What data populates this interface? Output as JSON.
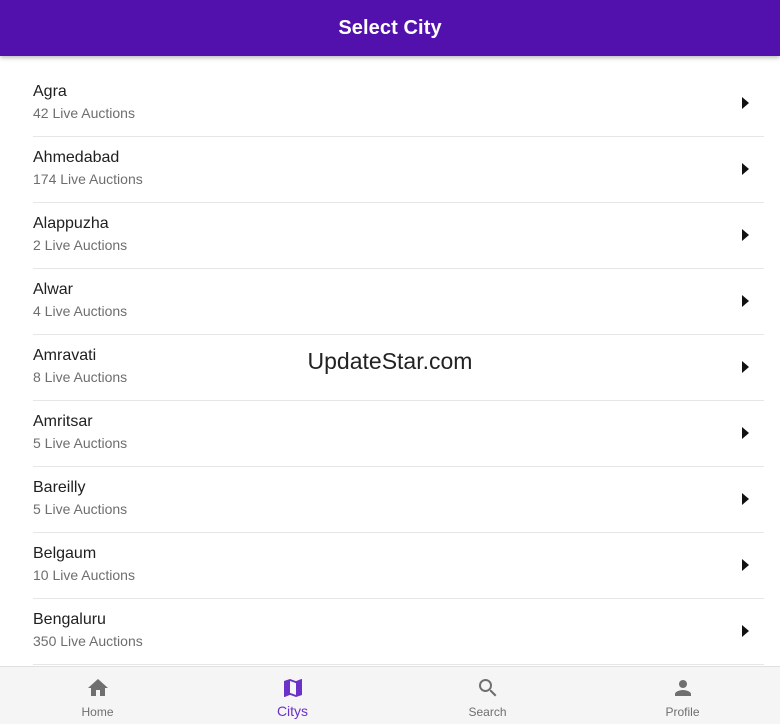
{
  "header": {
    "title": "Select City"
  },
  "cities": [
    {
      "name": "Agra",
      "count": "42 Live Auctions"
    },
    {
      "name": "Ahmedabad",
      "count": "174 Live Auctions"
    },
    {
      "name": "Alappuzha",
      "count": "2 Live Auctions"
    },
    {
      "name": "Alwar",
      "count": "4 Live Auctions"
    },
    {
      "name": "Amravati",
      "count": "8 Live Auctions"
    },
    {
      "name": "Amritsar",
      "count": "5 Live Auctions"
    },
    {
      "name": "Bareilly",
      "count": "5 Live Auctions"
    },
    {
      "name": "Belgaum",
      "count": "10 Live Auctions"
    },
    {
      "name": "Bengaluru",
      "count": "350 Live Auctions"
    }
  ],
  "watermark": "UpdateStar.com",
  "tabs": [
    {
      "label": "Home",
      "icon": "home-icon"
    },
    {
      "label": "Citys",
      "icon": "map-icon",
      "active": true
    },
    {
      "label": "Search",
      "icon": "search-icon"
    },
    {
      "label": "Profile",
      "icon": "person-icon"
    }
  ],
  "colors": {
    "header_bg": "#5211ac",
    "active_tab": "#6b31c8",
    "inactive_tab": "#6f6f6f",
    "arrow": "#111111"
  }
}
